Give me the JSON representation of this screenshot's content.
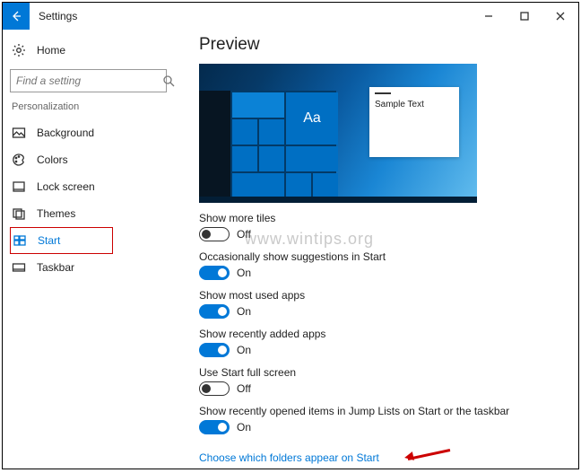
{
  "titlebar": {
    "title": "Settings"
  },
  "sidebar": {
    "home": "Home",
    "search_placeholder": "Find a setting",
    "section": "Personalization",
    "items": [
      {
        "label": "Background"
      },
      {
        "label": "Colors"
      },
      {
        "label": "Lock screen"
      },
      {
        "label": "Themes"
      },
      {
        "label": "Start"
      },
      {
        "label": "Taskbar"
      }
    ]
  },
  "main": {
    "heading": "Preview",
    "preview": {
      "aa_label": "Aa",
      "sample_text": "Sample Text"
    },
    "settings": [
      {
        "label": "Show more tiles",
        "state_text": "Off",
        "on": false
      },
      {
        "label": "Occasionally show suggestions in Start",
        "state_text": "On",
        "on": true
      },
      {
        "label": "Show most used apps",
        "state_text": "On",
        "on": true
      },
      {
        "label": "Show recently added apps",
        "state_text": "On",
        "on": true
      },
      {
        "label": "Use Start full screen",
        "state_text": "Off",
        "on": false
      },
      {
        "label": "Show recently opened items in Jump Lists on Start or the taskbar",
        "state_text": "On",
        "on": true
      }
    ],
    "link": "Choose which folders appear on Start"
  },
  "watermark": "www.wintips.org"
}
